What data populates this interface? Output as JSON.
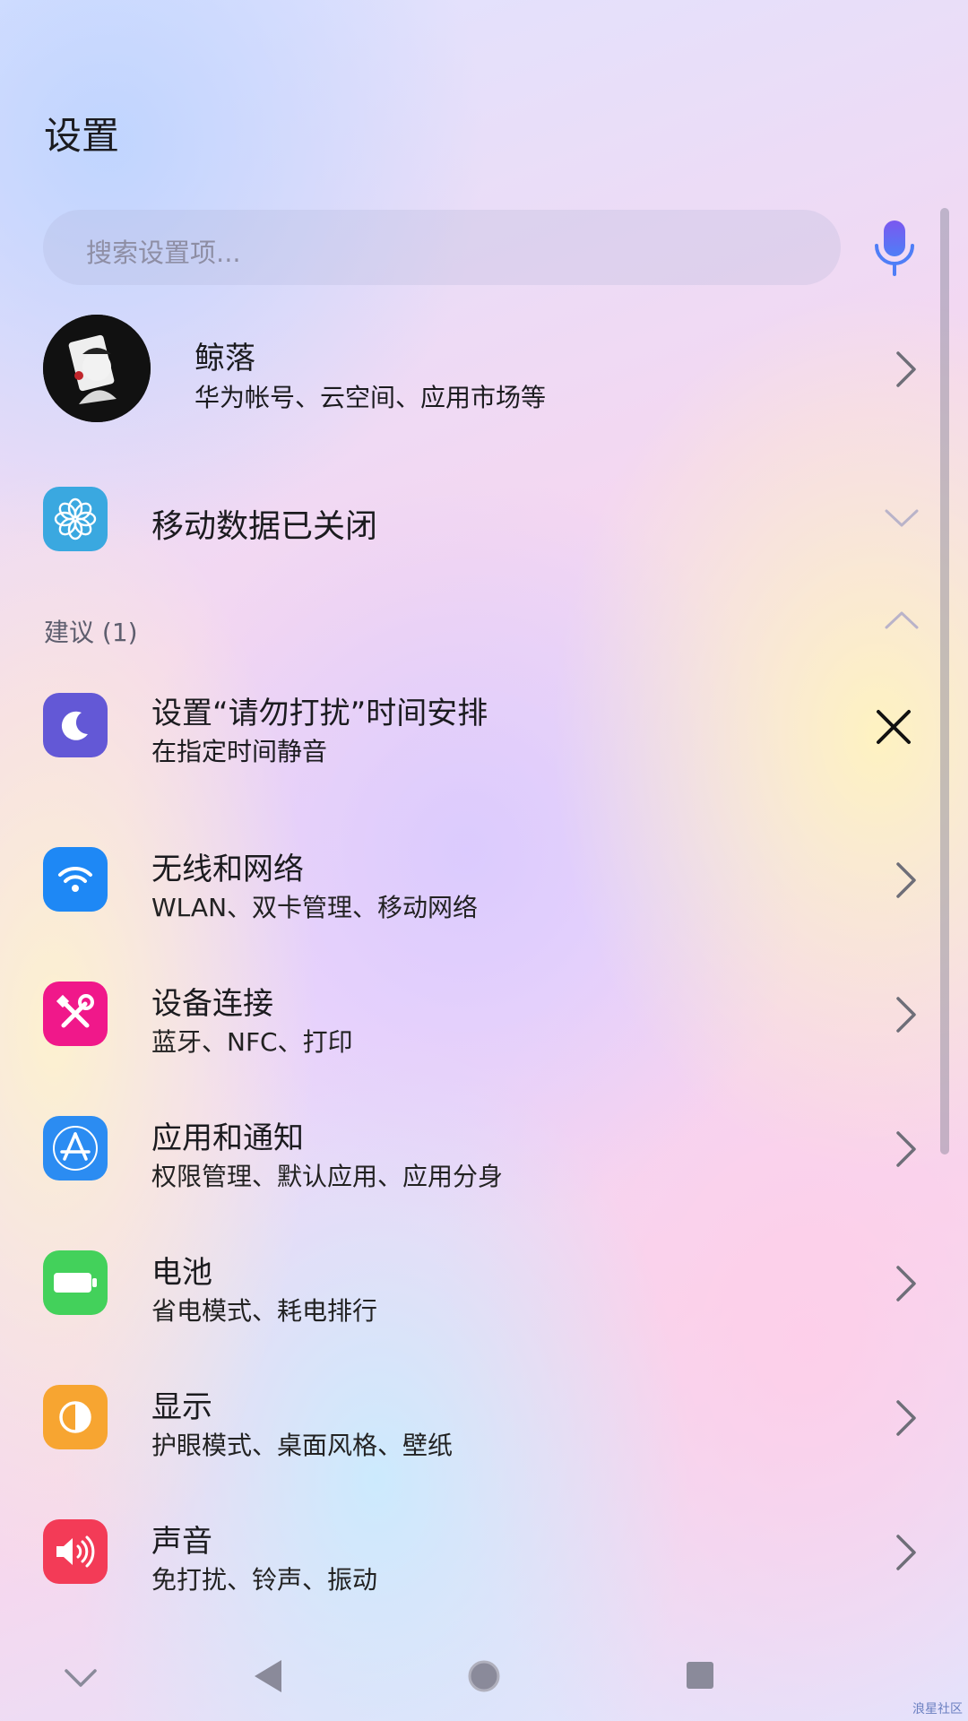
{
  "header": {
    "title": "设置"
  },
  "search": {
    "placeholder": "搜索设置项..."
  },
  "account": {
    "name": "鲸落",
    "subtitle": "华为帐号、云空间、应用市场等"
  },
  "mobile_data": {
    "label": "移动数据已关闭"
  },
  "suggestions": {
    "section_label": "建议 (1)",
    "item": {
      "title": "设置“请勿打扰”时间安排",
      "subtitle": "在指定时间静音"
    }
  },
  "settings": [
    {
      "title": "无线和网络",
      "subtitle": "WLAN、双卡管理、移动网络",
      "icon": "wifi-icon",
      "color": "#1e88f5"
    },
    {
      "title": "设备连接",
      "subtitle": "蓝牙、NFC、打印",
      "icon": "tools-icon",
      "color": "#f0188a"
    },
    {
      "title": "应用和通知",
      "subtitle": "权限管理、默认应用、应用分身",
      "icon": "app-store-icon",
      "color": "#2b8cf2"
    },
    {
      "title": "电池",
      "subtitle": "省电模式、耗电排行",
      "icon": "battery-icon",
      "color": "#43d15b"
    },
    {
      "title": "显示",
      "subtitle": "护眼模式、桌面风格、壁纸",
      "icon": "display-icon",
      "color": "#f7a531"
    },
    {
      "title": "声音",
      "subtitle": "免打扰、铃声、振动",
      "icon": "speaker-icon",
      "color": "#f33b57"
    }
  ],
  "colors": {
    "mobile_data_icon": "#3aa8e0",
    "dnd_icon": "#6358d6",
    "mic_accent": "#6b5cf0"
  },
  "watermark": "浪星社区"
}
